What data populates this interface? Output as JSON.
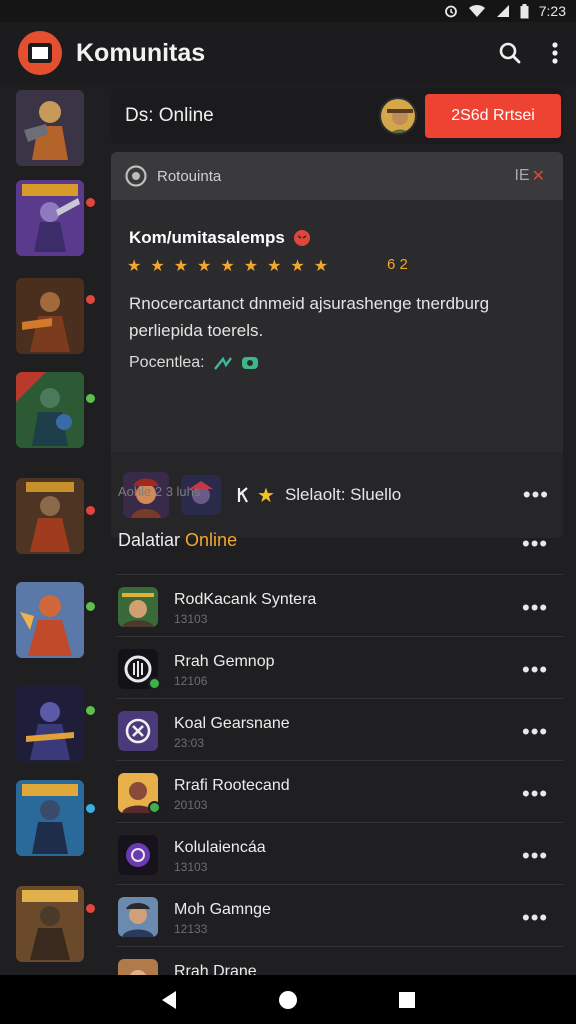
{
  "status_bar": {
    "time": "7:23"
  },
  "app": {
    "title": "Komunitas"
  },
  "online_status": {
    "label": "Ds: Online",
    "button_label": "2S6d Rrtsei"
  },
  "community_card": {
    "header_label": "Rotouinta",
    "header_right": "IE",
    "title": "Kom/umitasalemps",
    "stars": [
      "★",
      "★",
      "★",
      "★",
      "★",
      "★",
      "★",
      "★",
      "★"
    ],
    "rating": "6 2",
    "description": "Rnocercartanct dnmeid ajsurashenge tnerdburg perliepida toerels.",
    "footer_label": "Pocentlea:"
  },
  "players": {
    "label": "Slelaolt: Sluello"
  },
  "active_caption": "Aohle 2 3 luhs",
  "friends_section": {
    "title_prefix": "Dalatiar",
    "title_highlight": "Online"
  },
  "friends": [
    {
      "name": "RodKacank Syntera",
      "sub": "13103"
    },
    {
      "name": "Rrah Gemnop",
      "sub": "12106"
    },
    {
      "name": "Koal Gearsnane",
      "sub": "23:03"
    },
    {
      "name": "Rrafi Rootecand",
      "sub": "20103"
    },
    {
      "name": "Kolulaiencáa",
      "sub": "13103"
    },
    {
      "name": "Moh Gamnge",
      "sub": "12133"
    },
    {
      "name": "Rrah Drane",
      "sub": ""
    }
  ],
  "colors": {
    "accent": "#ee4332",
    "highlight": "#f2a72c",
    "online": "#3cb14a",
    "background": "#1f1f21"
  }
}
